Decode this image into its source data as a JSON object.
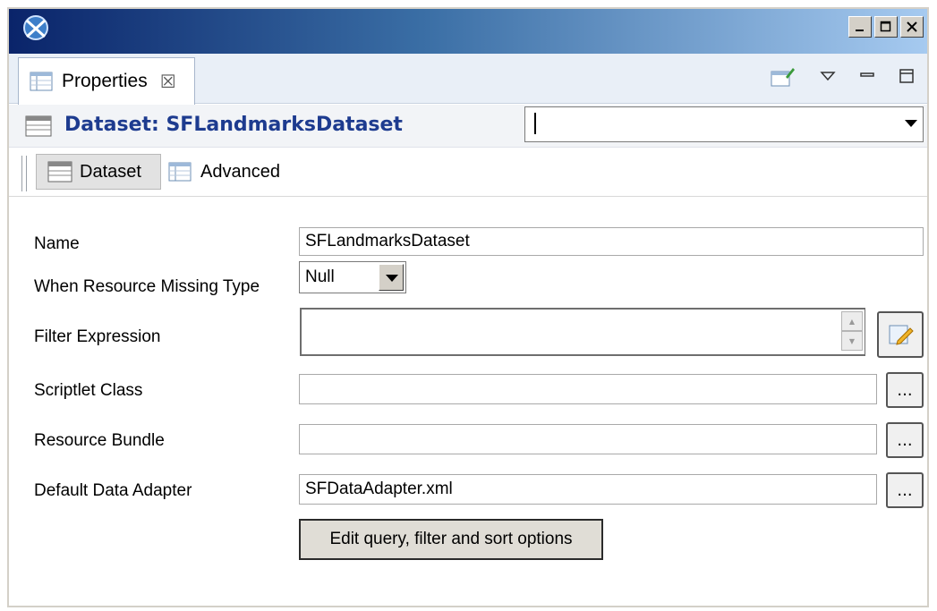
{
  "window": {
    "controls": {
      "minimize": "_",
      "maximize": "□",
      "close": "×"
    }
  },
  "tab": {
    "label": "Properties",
    "close_symbol": "☒"
  },
  "header": {
    "title": "Dataset: SFLandmarksDataset",
    "combo_value": ""
  },
  "subtabs": [
    {
      "label": "Dataset",
      "selected": true
    },
    {
      "label": "Advanced",
      "selected": false
    }
  ],
  "form": {
    "name": {
      "label": "Name",
      "value": "SFLandmarksDataset"
    },
    "when_resource_missing": {
      "label": "When Resource Missing Type",
      "value": "Null"
    },
    "filter_expression": {
      "label": "Filter Expression",
      "value": ""
    },
    "scriptlet_class": {
      "label": "Scriptlet Class",
      "value": "",
      "button": "..."
    },
    "resource_bundle": {
      "label": "Resource Bundle",
      "value": "",
      "button": "..."
    },
    "default_data_adapter": {
      "label": "Default Data Adapter",
      "value": "SFDataAdapter.xml",
      "button": "..."
    },
    "edit_query_button": "Edit query, filter and sort options"
  }
}
